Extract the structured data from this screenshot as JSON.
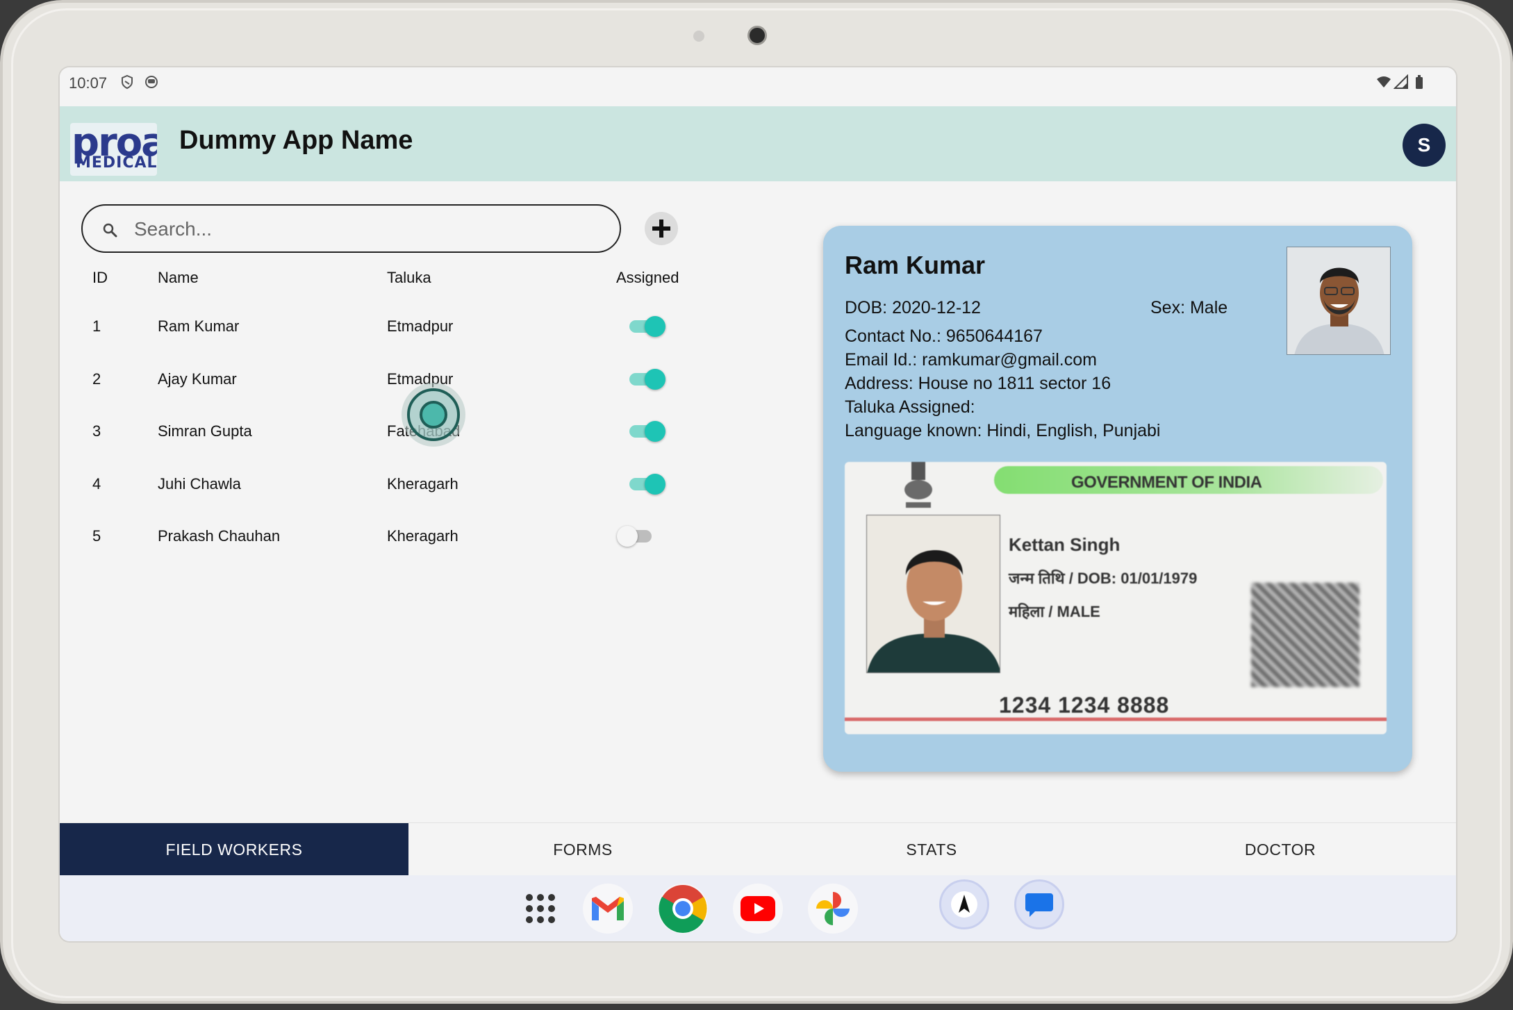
{
  "status_bar": {
    "time": "10:07"
  },
  "app": {
    "title": "Dummy App Name",
    "logo_main": "proa",
    "logo_sub": "MEDICAL",
    "avatar_initial": "S"
  },
  "search": {
    "placeholder": "Search..."
  },
  "table": {
    "headers": {
      "id": "ID",
      "name": "Name",
      "taluka": "Taluka",
      "assigned": "Assigned"
    },
    "rows": [
      {
        "id": "1",
        "name": "Ram Kumar",
        "taluka": "Etmadpur",
        "assigned": true
      },
      {
        "id": "2",
        "name": "Ajay Kumar",
        "taluka": "Etmadpur",
        "assigned": true
      },
      {
        "id": "3",
        "name": "Simran Gupta",
        "taluka": "Fatehabad",
        "assigned": true
      },
      {
        "id": "4",
        "name": "Juhi Chawla",
        "taluka": "Kheragarh",
        "assigned": true
      },
      {
        "id": "5",
        "name": "Prakash Chauhan",
        "taluka": "Kheragarh",
        "assigned": false
      }
    ]
  },
  "detail": {
    "name": "Ram Kumar",
    "dob": "DOB: 2020-12-12",
    "sex": "Sex: Male",
    "contact": "Contact No.: 9650644167",
    "email": "Email Id.: ramkumar@gmail.com",
    "address": "Address: House no 1811 sector 16",
    "taluka": "Taluka Assigned:",
    "languages": "Language known: Hindi, English, Punjabi",
    "id_card": {
      "header": "GOVERNMENT OF INDIA",
      "name": "Kettan Singh",
      "dob": "जन्म तिथि / DOB: 01/01/1979",
      "gender": "महिला / MALE",
      "number": "1234 1234 8888"
    }
  },
  "tabs": [
    {
      "label": "FIELD WORKERS",
      "active": true
    },
    {
      "label": "FORMS",
      "active": false
    },
    {
      "label": "STATS",
      "active": false
    },
    {
      "label": "DOCTOR",
      "active": false
    }
  ],
  "dock": [
    "apps-grid-icon",
    "gmail-icon",
    "chrome-icon",
    "youtube-icon",
    "photos-icon",
    "app-icon",
    "messages-icon"
  ],
  "colors": {
    "header_bg": "#cbe5e0",
    "accent": "#1ec4b5",
    "tab_active": "#17274a",
    "card_bg": "#a9cde5"
  }
}
